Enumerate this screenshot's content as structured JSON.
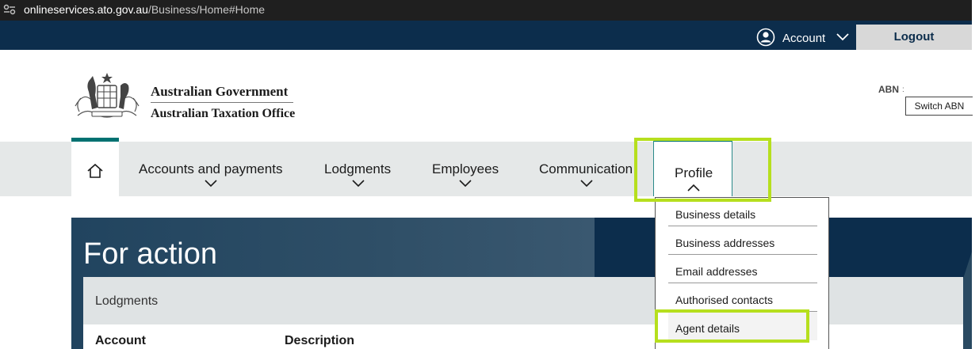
{
  "browser": {
    "url_host": "onlineservices.ato.gov.au",
    "url_path": "/Business/Home#Home"
  },
  "topbar": {
    "account_label": "Account",
    "logout_label": "Logout"
  },
  "header": {
    "gov_name": "Australian Government",
    "agency_name": "Australian Taxation Office",
    "abn_label": "ABN",
    "abn_colon": ":",
    "switch_abn_label": "Switch ABN"
  },
  "nav": {
    "items": [
      {
        "label": "Accounts and payments"
      },
      {
        "label": "Lodgments"
      },
      {
        "label": "Employees"
      },
      {
        "label": "Communication"
      },
      {
        "label": "Profile"
      }
    ]
  },
  "profile_menu": {
    "items": [
      {
        "label": "Business details"
      },
      {
        "label": "Business addresses"
      },
      {
        "label": "Email addresses"
      },
      {
        "label": "Authorised contacts"
      },
      {
        "label": "Agent details"
      }
    ]
  },
  "main": {
    "title": "For action",
    "panel_title": "Lodgments",
    "columns": [
      "Account",
      "Description"
    ]
  },
  "colors": {
    "header_navy": "#0c2d4c",
    "accent_teal": "#007171",
    "highlight_green": "#b6df1e"
  }
}
